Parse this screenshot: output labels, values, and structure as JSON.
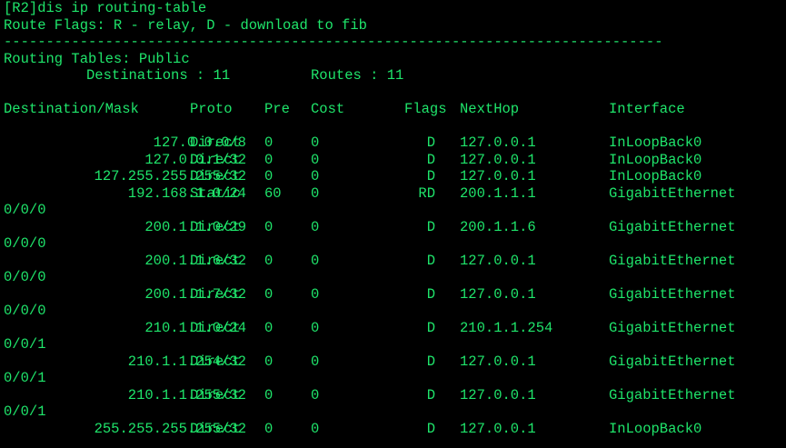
{
  "terminal": {
    "command_line": "[R2]dis ip routing-table",
    "flags_legend": "Route Flags: R - relay, D - download to fib",
    "separator": "------------------------------------------------------------------------------",
    "tables_label": "Routing Tables: Public",
    "destinations_label": "Destinations : 11",
    "routes_label": "Routes : 11",
    "text_color": "#1fe56b",
    "background_color": "#000000"
  },
  "table": {
    "headers": {
      "dest": "Destination/Mask",
      "proto": "Proto",
      "pre": "Pre",
      "cost": "Cost",
      "flags": "Flags",
      "nexthop": "NextHop",
      "iface": "Interface"
    },
    "rows": [
      {
        "dest": "127.0.0.0/8",
        "proto": "Direct",
        "pre": "0",
        "cost": "0",
        "flags": "D",
        "nexthop": "127.0.0.1",
        "iface": "InLoopBack0",
        "wrap": ""
      },
      {
        "dest": "127.0.0.1/32",
        "proto": "Direct",
        "pre": "0",
        "cost": "0",
        "flags": "D",
        "nexthop": "127.0.0.1",
        "iface": "InLoopBack0",
        "wrap": ""
      },
      {
        "dest": "127.255.255.255/32",
        "proto": "Direct",
        "pre": "0",
        "cost": "0",
        "flags": "D",
        "nexthop": "127.0.0.1",
        "iface": "InLoopBack0",
        "wrap": ""
      },
      {
        "dest": "192.168.1.0/24",
        "proto": "Static",
        "pre": "60",
        "cost": "0",
        "flags": "RD",
        "nexthop": "200.1.1.1",
        "iface": "GigabitEthernet",
        "wrap": "0/0/0"
      },
      {
        "dest": "200.1.1.0/29",
        "proto": "Direct",
        "pre": "0",
        "cost": "0",
        "flags": "D",
        "nexthop": "200.1.1.6",
        "iface": "GigabitEthernet",
        "wrap": "0/0/0"
      },
      {
        "dest": "200.1.1.6/32",
        "proto": "Direct",
        "pre": "0",
        "cost": "0",
        "flags": "D",
        "nexthop": "127.0.0.1",
        "iface": "GigabitEthernet",
        "wrap": "0/0/0"
      },
      {
        "dest": "200.1.1.7/32",
        "proto": "Direct",
        "pre": "0",
        "cost": "0",
        "flags": "D",
        "nexthop": "127.0.0.1",
        "iface": "GigabitEthernet",
        "wrap": "0/0/0"
      },
      {
        "dest": "210.1.1.0/24",
        "proto": "Direct",
        "pre": "0",
        "cost": "0",
        "flags": "D",
        "nexthop": "210.1.1.254",
        "iface": "GigabitEthernet",
        "wrap": "0/0/1"
      },
      {
        "dest": "210.1.1.254/32",
        "proto": "Direct",
        "pre": "0",
        "cost": "0",
        "flags": "D",
        "nexthop": "127.0.0.1",
        "iface": "GigabitEthernet",
        "wrap": "0/0/1"
      },
      {
        "dest": "210.1.1.255/32",
        "proto": "Direct",
        "pre": "0",
        "cost": "0",
        "flags": "D",
        "nexthop": "127.0.0.1",
        "iface": "GigabitEthernet",
        "wrap": "0/0/1"
      },
      {
        "dest": "255.255.255.255/32",
        "proto": "Direct",
        "pre": "0",
        "cost": "0",
        "flags": "D",
        "nexthop": "127.0.0.1",
        "iface": "InLoopBack0",
        "wrap": ""
      }
    ]
  }
}
